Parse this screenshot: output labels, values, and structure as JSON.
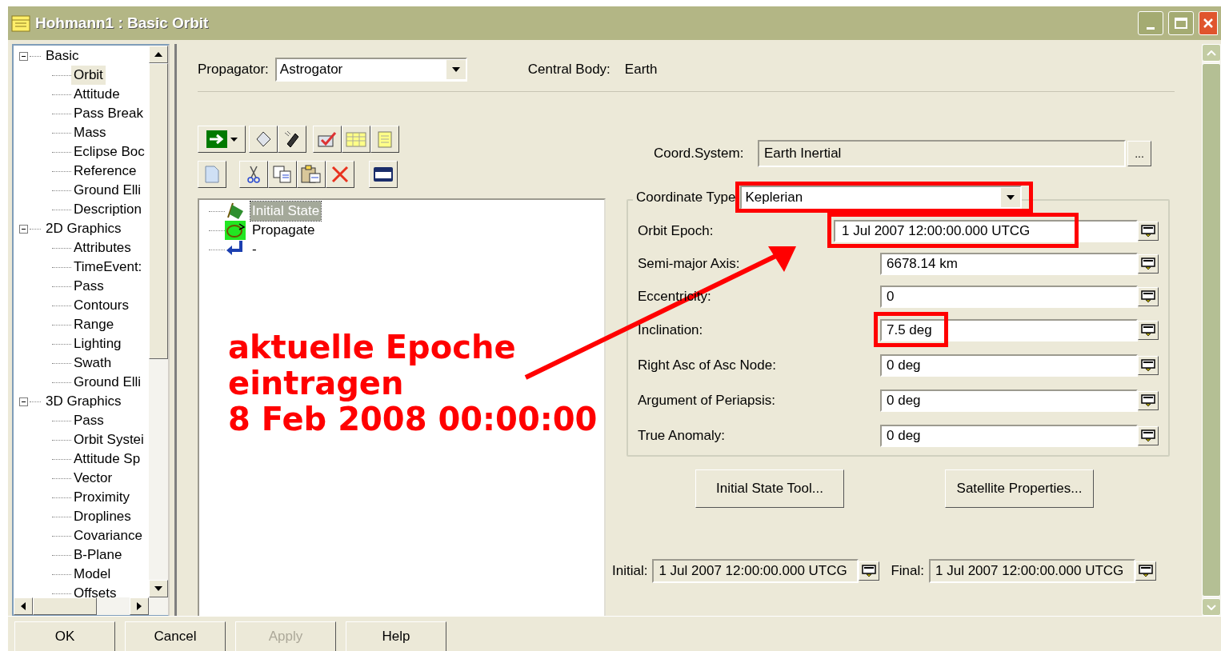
{
  "window": {
    "title": "Hohmann1 : Basic Orbit"
  },
  "sidebar": {
    "items": [
      {
        "label": "Basic",
        "expanded": true,
        "children": [
          {
            "label": "Orbit",
            "selected": true
          },
          {
            "label": "Attitude",
            "selected": false
          },
          {
            "label": "Pass Break",
            "selected": false
          },
          {
            "label": "Mass",
            "selected": false
          },
          {
            "label": "Eclipse Boc",
            "selected": false
          },
          {
            "label": "Reference",
            "selected": false
          },
          {
            "label": "Ground Elli",
            "selected": false
          },
          {
            "label": "Description",
            "selected": false
          }
        ]
      },
      {
        "label": "2D Graphics",
        "expanded": true,
        "children": [
          {
            "label": "Attributes",
            "selected": false
          },
          {
            "label": "TimeEvent:",
            "selected": false
          },
          {
            "label": "Pass",
            "selected": false
          },
          {
            "label": "Contours",
            "selected": false
          },
          {
            "label": "Range",
            "selected": false
          },
          {
            "label": "Lighting",
            "selected": false
          },
          {
            "label": "Swath",
            "selected": false
          },
          {
            "label": "Ground Elli",
            "selected": false
          }
        ]
      },
      {
        "label": "3D Graphics",
        "expanded": true,
        "children": [
          {
            "label": "Pass",
            "selected": false
          },
          {
            "label": "Orbit Systei",
            "selected": false
          },
          {
            "label": "Attitude Sp",
            "selected": false
          },
          {
            "label": "Vector",
            "selected": false
          },
          {
            "label": "Proximity",
            "selected": false
          },
          {
            "label": "Droplines",
            "selected": false
          },
          {
            "label": "Covariance",
            "selected": false
          },
          {
            "label": "B-Plane",
            "selected": false
          },
          {
            "label": "Model",
            "selected": false
          },
          {
            "label": "Offsets",
            "selected": false
          }
        ]
      }
    ]
  },
  "propagator": {
    "label": "Propagator:",
    "value": "Astrogator"
  },
  "central_body": {
    "label": "Central Body:",
    "value": "Earth"
  },
  "sequence": [
    {
      "label": "Initial State",
      "selected": true,
      "kind": "initial"
    },
    {
      "label": "Propagate",
      "selected": false,
      "kind": "propagate"
    },
    {
      "label": "-",
      "selected": false,
      "kind": "return"
    }
  ],
  "coord_system": {
    "label": "Coord.System:",
    "value": "Earth Inertial",
    "button": "..."
  },
  "coordinate_type": {
    "label": "Coordinate Type",
    "value": "Keplerian",
    "highlighted": true
  },
  "elements": [
    {
      "label": "Orbit Epoch:",
      "value": "1 Jul 2007 12:00:00.000 UTCG",
      "highlighted": true
    },
    {
      "label": "Semi-major Axis:",
      "value": "6678.14 km",
      "highlighted": false
    },
    {
      "label": "Eccentricity:",
      "value": "0",
      "highlighted": false
    },
    {
      "label": "Inclination:",
      "value": "7.5 deg",
      "highlighted": true
    },
    {
      "label": "Right Asc of Asc Node:",
      "value": "0 deg",
      "highlighted": false
    },
    {
      "label": "Argument of Periapsis:",
      "value": "0 deg",
      "highlighted": false
    },
    {
      "label": "True Anomaly:",
      "value": "0 deg",
      "highlighted": false
    }
  ],
  "tool_buttons": [
    "Initial State Tool...",
    "Satellite Properties..."
  ],
  "time_range": [
    {
      "label": "Initial:",
      "value": "1 Jul 2007 12:00:00.000 UTCG"
    },
    {
      "label": "Final:",
      "value": "1 Jul 2007 12:00:00.000 UTCG"
    }
  ],
  "dialog_buttons": [
    {
      "label": "OK",
      "disabled": false
    },
    {
      "label": "Cancel",
      "disabled": false
    },
    {
      "label": "Apply",
      "disabled": true
    },
    {
      "label": "Help",
      "disabled": false
    }
  ],
  "annotation": {
    "lines": [
      "aktuelle Epoche",
      "eintragen",
      "8 Feb 2008 00:00:00"
    ]
  }
}
